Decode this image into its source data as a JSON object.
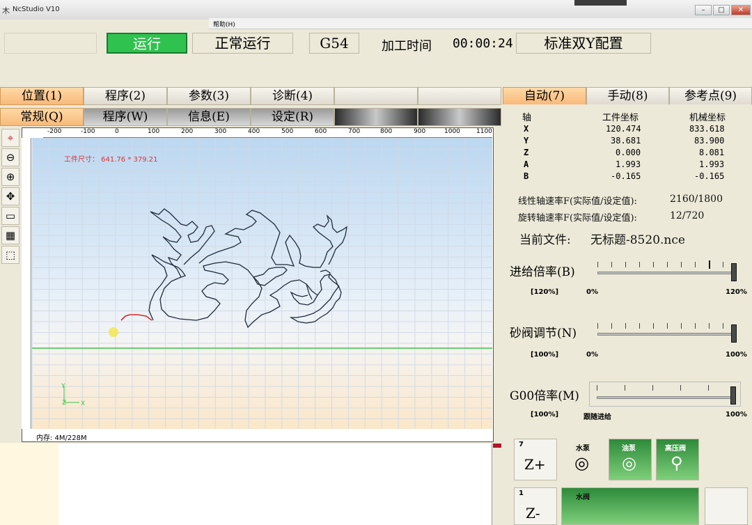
{
  "window": {
    "title": "NcStudio V10",
    "icon": "木",
    "menu_help": "帮助(H)",
    "minimize": "–",
    "maximize": "□",
    "close": "✕"
  },
  "status": {
    "run": "运行",
    "mode": "正常运行",
    "coord_sys": "G54",
    "time_label": "加工时间",
    "time_value": "00:00:24",
    "config": "标准双Y配置"
  },
  "tabs_left_top": [
    "位置(1)",
    "程序(2)",
    "参数(3)",
    "诊断(4)",
    "",
    ""
  ],
  "tabs_left_bottom": [
    "常规(Q)",
    "程序(W)",
    "信息(E)",
    "设定(R)",
    "",
    ""
  ],
  "tabs_right": [
    "自动(7)",
    "手动(8)",
    "参考点(9)"
  ],
  "toolbar_icons": [
    "crosshair-icon",
    "zoom-out-icon",
    "zoom-in-icon",
    "target-icon",
    "window-icon",
    "table-icon",
    "cube-icon"
  ],
  "ruler_h": [
    "-200",
    "-100",
    "0",
    "100",
    "200",
    "300",
    "400",
    "500",
    "600",
    "700",
    "800",
    "900",
    "1000",
    "1100"
  ],
  "canvas": {
    "workpiece_size": "工件尺寸： 641.76 * 379.21",
    "memory": "内存: 4M/228M",
    "axis_y": "Y",
    "axis_z": "Z",
    "axis_x": "X"
  },
  "coords": {
    "head_axis": "轴",
    "head_work": "工件坐标",
    "head_machine": "机械坐标",
    "rows": [
      {
        "axis": "X",
        "work": "120.474",
        "machine": "833.618"
      },
      {
        "axis": "Y",
        "work": "38.681",
        "machine": "83.900"
      },
      {
        "axis": "Z",
        "work": "0.000",
        "machine": "8.081"
      },
      {
        "axis": "A",
        "work": "1.993",
        "machine": "1.993"
      },
      {
        "axis": "B",
        "work": "-0.165",
        "machine": "-0.165"
      }
    ]
  },
  "feed": {
    "linear_label": "线性轴速率F(实际值/设定值):",
    "linear_value": "2160/1800",
    "rotary_label": "旋转轴速率F(实际值/设定值):",
    "rotary_value": "12/720",
    "file_label": "当前文件:",
    "file_value": "无标题-8520.nce"
  },
  "sliders": [
    {
      "label": "进给倍率(B)",
      "current": "[120%]",
      "min": "0%",
      "max": "120%",
      "level": 1.0
    },
    {
      "label": "砂阀调节(N)",
      "current": "[100%]",
      "min": "0%",
      "max": "100%",
      "level": 1.0
    },
    {
      "label": "G00倍率(M)",
      "current": "[100%]",
      "min": "跟随进给",
      "max": "100%",
      "level": 1.0
    }
  ],
  "jog": {
    "zplus_num": "7",
    "zplus": "Z+",
    "zminus_num": "1",
    "zminus": "Z-",
    "water_pump": "水泵",
    "oil_pump": "油泵",
    "high_valve": "高压阀",
    "water_valve": "水阀"
  },
  "colors": {
    "run_green": "#2fc24f",
    "tab_active": "#f7b97a",
    "toolpath": "#1e2a3a",
    "axis_green": "#3cc24a"
  }
}
